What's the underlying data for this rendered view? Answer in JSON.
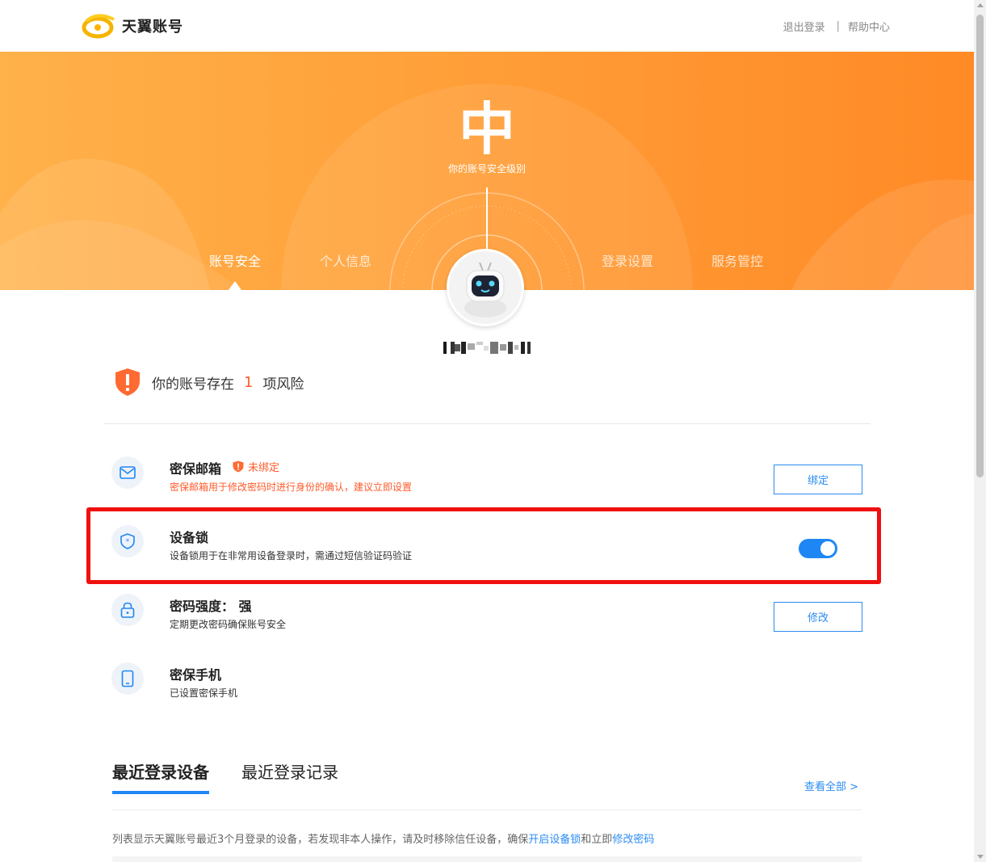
{
  "header": {
    "brand": "天翼账号",
    "logout_label": "退出登录",
    "separator": "|",
    "help_label": "帮助中心"
  },
  "banner": {
    "level": "中",
    "level_caption": "你的账号安全级别",
    "tabs": [
      {
        "label": "账号安全",
        "active": true
      },
      {
        "label": "个人信息",
        "active": false
      },
      {
        "label": "登录设置",
        "active": false
      },
      {
        "label": "服务管控",
        "active": false
      }
    ]
  },
  "risk": {
    "prefix": "你的账号存在",
    "count": "1",
    "suffix": "项风险"
  },
  "items": {
    "email": {
      "title": "密保邮箱",
      "status": "未绑定",
      "desc": "密保邮箱用于修改密码时进行身份的确认，建议立即设置",
      "button": "绑定",
      "icon": "mail-icon"
    },
    "device_lock": {
      "title": "设备锁",
      "desc": "设备锁用于在非常用设备登录时，需通过短信验证码验证",
      "enabled": true,
      "icon": "shield-star-icon"
    },
    "password": {
      "title": "密码强度：  强",
      "desc": "定期更改密码确保账号安全",
      "button": "修改",
      "icon": "lock-icon"
    },
    "phone": {
      "title": "密保手机",
      "desc": "已设置密保手机",
      "icon": "phone-icon"
    }
  },
  "devices": {
    "tabs": [
      {
        "label": "最近登录设备",
        "active": true
      },
      {
        "label": "最近登录记录",
        "active": false
      }
    ],
    "view_all": "查看全部 >",
    "notice_prefix": "列表显示天翼账号最近3个月登录的设备，若发现非本人操作，请及时移除信任设备，确保",
    "notice_link1": "开启设备锁",
    "notice_mid": "和立即",
    "notice_link2": "修改密码"
  },
  "colors": {
    "accent_blue": "#1f87f5",
    "warning_orange": "#ff5b2b",
    "banner_orange": "#ff9530",
    "highlight_red": "#ef1010"
  }
}
